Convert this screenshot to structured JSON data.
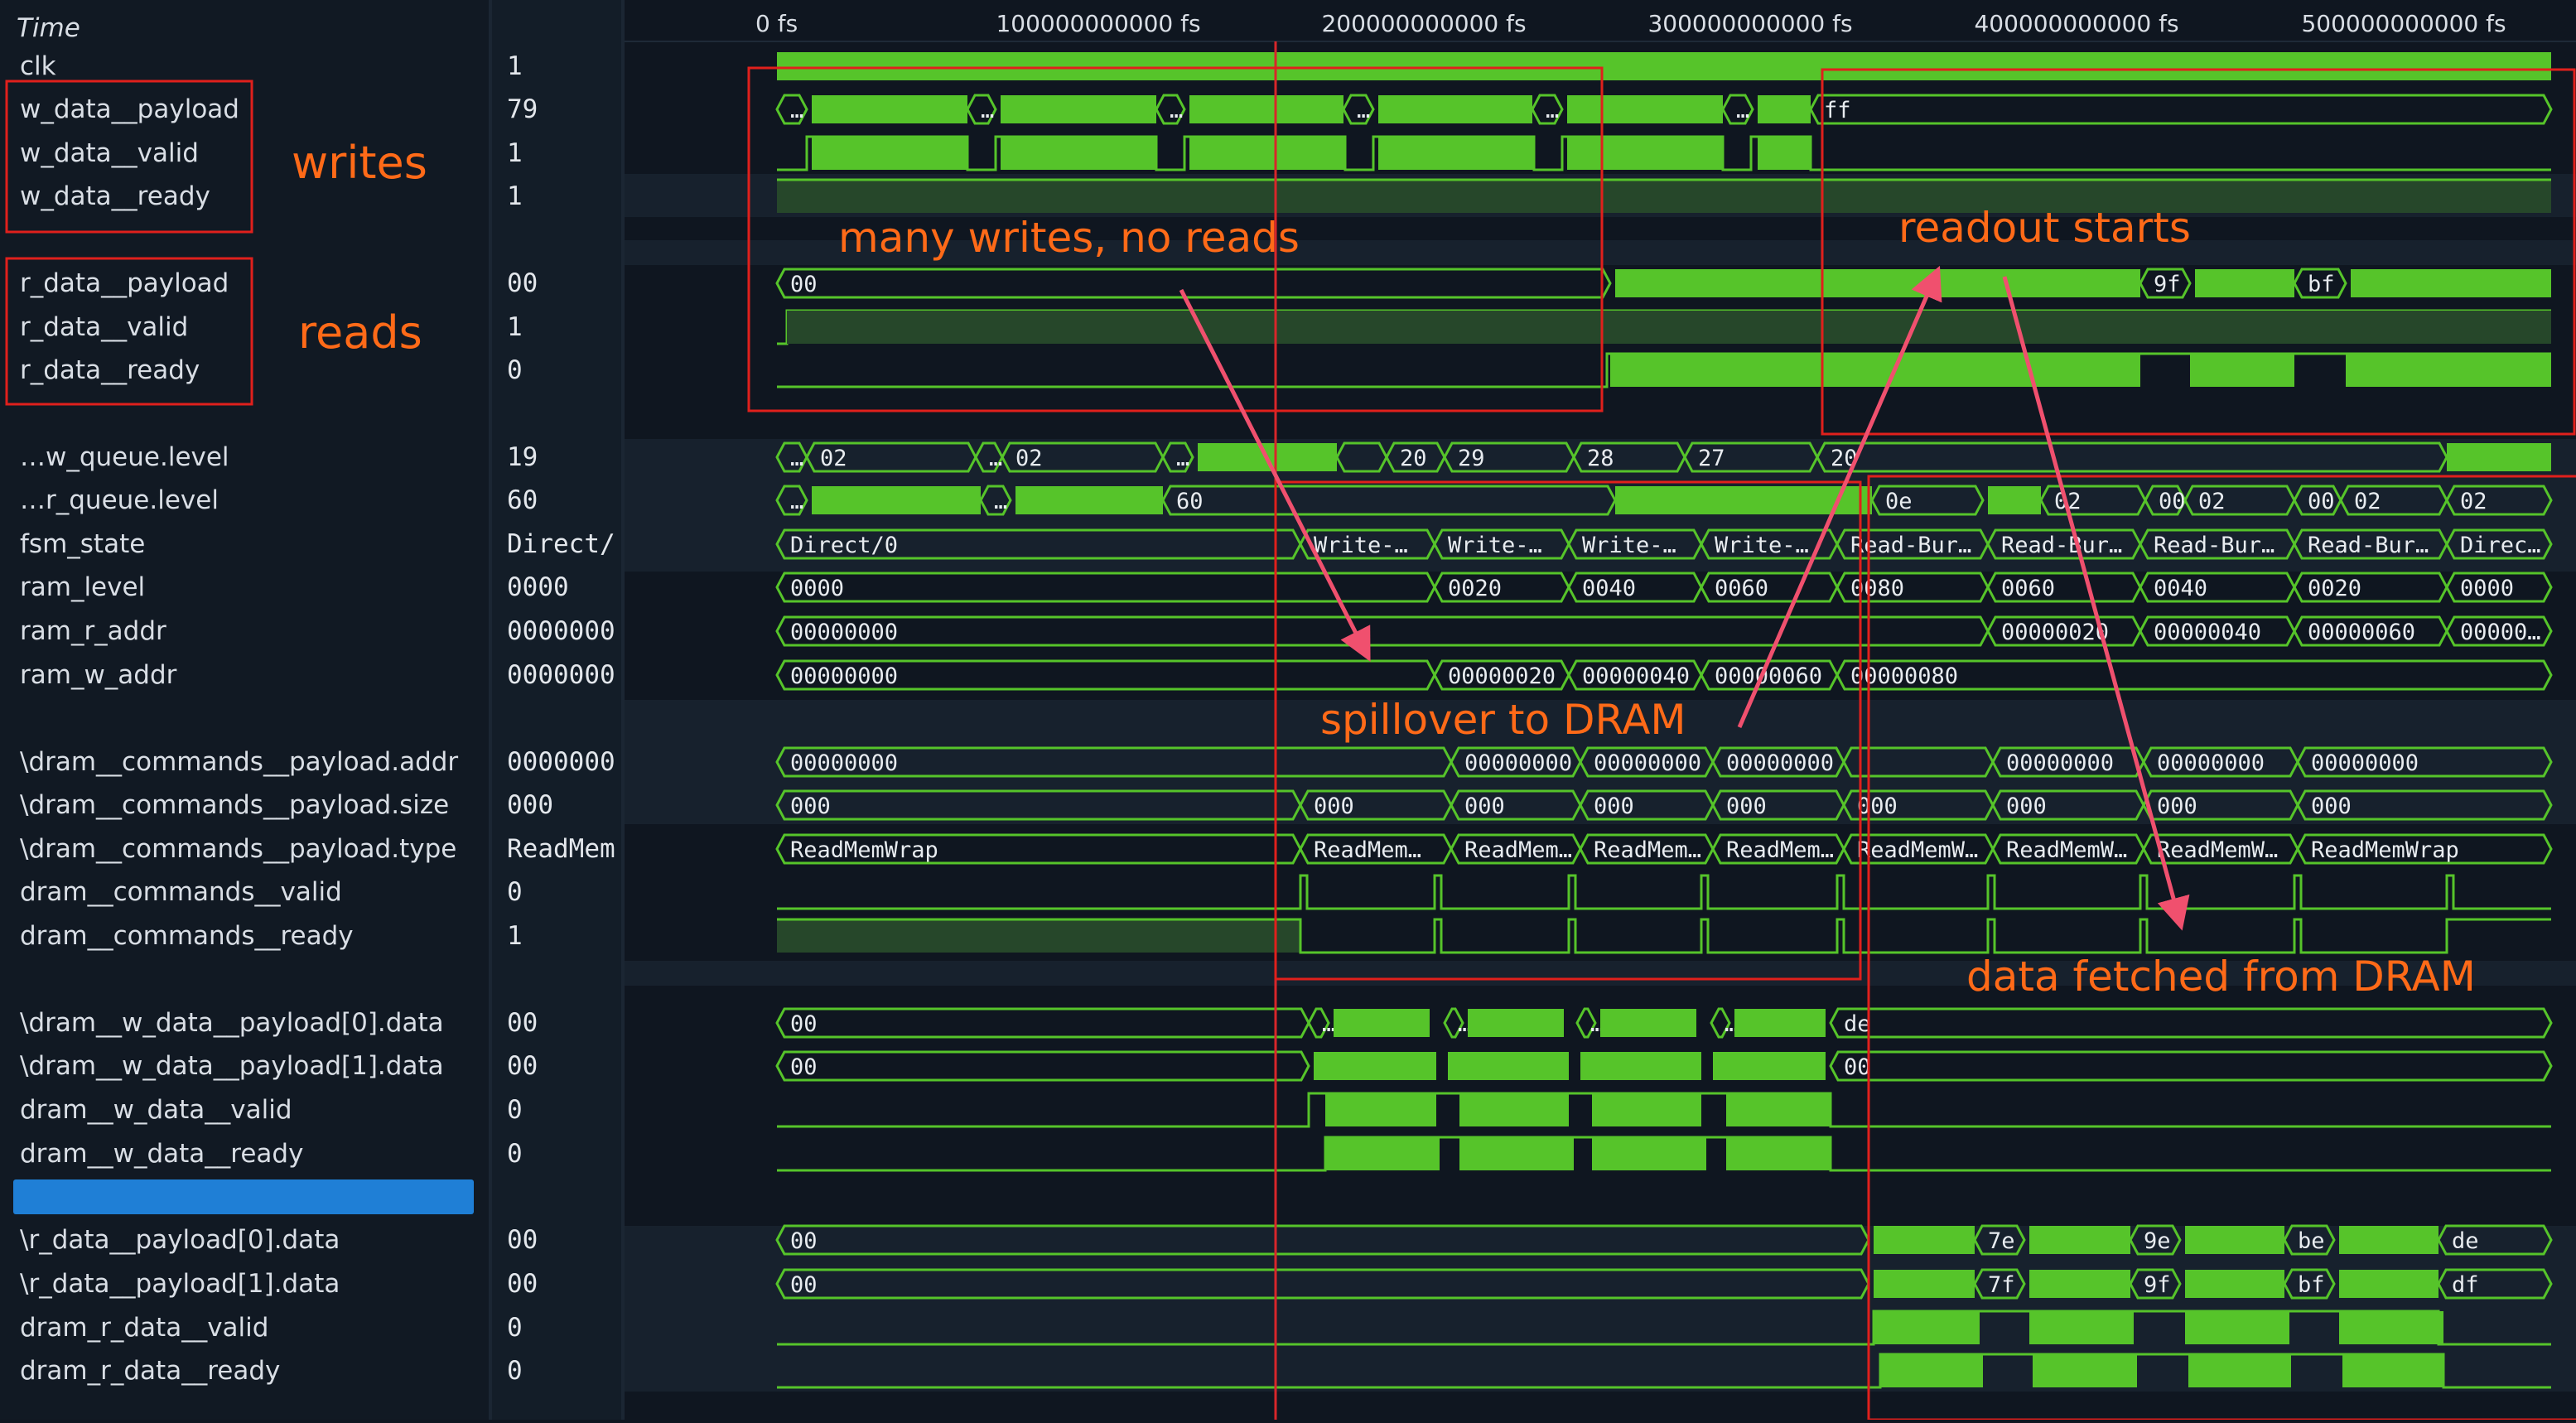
{
  "time_ruler": {
    "label": "Time",
    "ticks": [
      "0 fs",
      "100000000000 fs",
      "200000000000 fs",
      "300000000000 fs",
      "400000000000 fs",
      "500000000000 fs"
    ]
  },
  "signals": [
    {
      "id": "clk",
      "name": "clk",
      "value": "1",
      "kind": "clock"
    },
    {
      "id": "w_data_payload",
      "name": "w_data__payload",
      "value": "79",
      "kind": "bus",
      "labels": [
        "…",
        "…",
        "…",
        "…",
        "…",
        "…",
        "ff"
      ]
    },
    {
      "id": "w_data_valid",
      "name": "w_data__valid",
      "value": "1",
      "kind": "bit"
    },
    {
      "id": "w_data_ready",
      "name": "w_data__ready",
      "value": "1",
      "kind": "bit"
    },
    {
      "id": "r_data_payload",
      "name": "r_data__payload",
      "value": "00",
      "kind": "bus",
      "labels": [
        "00",
        "9f",
        "bf"
      ]
    },
    {
      "id": "r_data_valid",
      "name": "r_data__valid",
      "value": "1",
      "kind": "bit"
    },
    {
      "id": "r_data_ready",
      "name": "r_data__ready",
      "value": "0",
      "kind": "bit"
    },
    {
      "id": "w_queue_level",
      "name": "…w_queue.level",
      "value": "19",
      "kind": "bus",
      "labels": [
        "…",
        "02",
        "…",
        "02",
        "…",
        "20",
        "29",
        "28",
        "27",
        "20"
      ]
    },
    {
      "id": "r_queue_level",
      "name": "…r_queue.level",
      "value": "60",
      "kind": "bus",
      "labels": [
        "…",
        "…",
        "60",
        "0e",
        "02",
        "00",
        "02",
        "00",
        "02",
        "02"
      ]
    },
    {
      "id": "fsm_state",
      "name": "fsm_state",
      "value": "Direct/",
      "kind": "bus",
      "labels": [
        "Direct/0",
        "Write-…",
        "Write-…",
        "Write-…",
        "Write-…",
        "Read-Bur…",
        "Read-Bur…",
        "Read-Bur…",
        "Read-Bur…",
        "Direc…"
      ]
    },
    {
      "id": "ram_level",
      "name": "ram_level",
      "value": "0000",
      "kind": "bus",
      "labels": [
        "0000",
        "0020",
        "0040",
        "0060",
        "0080",
        "0060",
        "0040",
        "0020",
        "0000"
      ]
    },
    {
      "id": "ram_r_addr",
      "name": "ram_r_addr",
      "value": "0000000",
      "kind": "bus",
      "labels": [
        "00000000",
        "00000020",
        "00000040",
        "00000060",
        "00000…"
      ]
    },
    {
      "id": "ram_w_addr",
      "name": "ram_w_addr",
      "value": "0000000",
      "kind": "bus",
      "labels": [
        "00000000",
        "00000020",
        "00000040",
        "00000060",
        "00000080"
      ]
    },
    {
      "id": "dram_cmd_addr",
      "name": "\\dram__commands__payload.addr",
      "value": "0000000",
      "kind": "bus",
      "labels": [
        "00000000",
        "00000000",
        "00000000",
        "00000000",
        "00000000",
        "00000000",
        "00000000"
      ]
    },
    {
      "id": "dram_cmd_size",
      "name": "\\dram__commands__payload.size",
      "value": "000",
      "kind": "bus",
      "labels": [
        "000",
        "000",
        "000",
        "000",
        "000",
        "000",
        "000",
        "000",
        "000"
      ]
    },
    {
      "id": "dram_cmd_type",
      "name": "\\dram__commands__payload.type",
      "value": "ReadMem",
      "kind": "bus",
      "labels": [
        "ReadMemWrap",
        "ReadMem…",
        "ReadMem…",
        "ReadMem…",
        "ReadMem…",
        "ReadMemW…",
        "ReadMemW…",
        "ReadMemW…",
        "ReadMemWrap"
      ]
    },
    {
      "id": "dram_cmd_valid",
      "name": "dram__commands__valid",
      "value": "0",
      "kind": "bit"
    },
    {
      "id": "dram_cmd_ready",
      "name": "dram__commands__ready",
      "value": "1",
      "kind": "bit"
    },
    {
      "id": "dram_w_p0",
      "name": "\\dram__w_data__payload[0].data",
      "value": "00",
      "kind": "bus",
      "labels": [
        "00",
        "…",
        "…",
        "…",
        "…",
        "de"
      ]
    },
    {
      "id": "dram_w_p1",
      "name": "\\dram__w_data__payload[1].data",
      "value": "00",
      "kind": "bus",
      "labels": [
        "00",
        "00"
      ]
    },
    {
      "id": "dram_w_valid",
      "name": "dram__w_data__valid",
      "value": "0",
      "kind": "bit"
    },
    {
      "id": "dram_w_ready",
      "name": "dram__w_data__ready",
      "value": "0",
      "kind": "bit"
    },
    {
      "id": "r_p0",
      "name": "\\r_data__payload[0].data",
      "value": "00",
      "kind": "bus",
      "labels": [
        "00",
        "7e",
        "9e",
        "be",
        "de"
      ]
    },
    {
      "id": "r_p1",
      "name": "\\r_data__payload[1].data",
      "value": "00",
      "kind": "bus",
      "labels": [
        "00",
        "7f",
        "9f",
        "bf",
        "df"
      ]
    },
    {
      "id": "dram_r_valid",
      "name": "dram_r_data__valid",
      "value": "0",
      "kind": "bit"
    },
    {
      "id": "dram_r_ready",
      "name": "dram_r_data__ready",
      "value": "0",
      "kind": "bit"
    }
  ],
  "annotations": {
    "writes": "writes",
    "reads": "reads",
    "many_writes": "many writes, no reads",
    "readout": "readout starts",
    "spillover": "spillover to DRAM",
    "fetched": "data fetched from DRAM"
  },
  "colors": {
    "wave": "#56c42a",
    "annotation": "#ff6a18",
    "box": "#e0201c",
    "arrow": "#f0506e",
    "cursor": "#d8262a",
    "divider": "#1f7fd6"
  }
}
